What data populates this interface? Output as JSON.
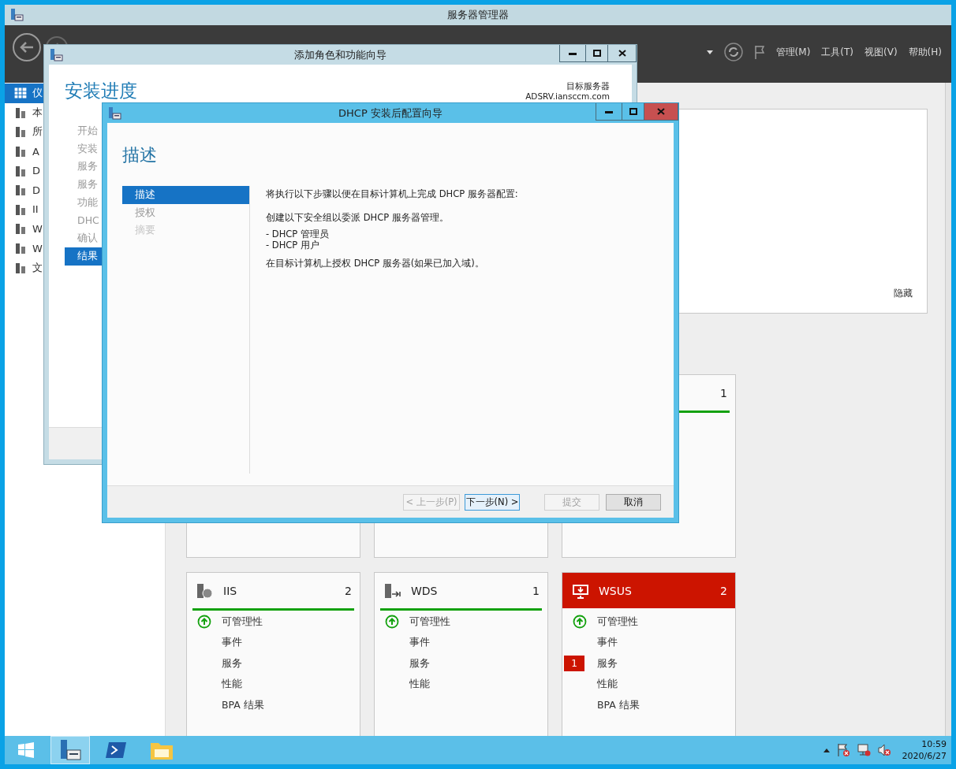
{
  "server_manager": {
    "title": "服务器管理器",
    "menus": [
      "管理(M)",
      "工具(T)",
      "视图(V)",
      "帮助(H)"
    ],
    "sidebar": [
      {
        "label": "仪",
        "selected": true
      },
      {
        "label": "本",
        "selected": false
      },
      {
        "label": "所",
        "selected": false
      },
      {
        "label": "A",
        "selected": false
      },
      {
        "label": "D",
        "selected": false
      },
      {
        "label": "D",
        "selected": false
      },
      {
        "label": "II",
        "selected": false
      },
      {
        "label": "W",
        "selected": false
      },
      {
        "label": "W",
        "selected": false
      },
      {
        "label": "文",
        "selected": false
      }
    ],
    "welcome_panel": {
      "hide_link": "隐藏"
    },
    "tiles": [
      [
        {
          "kind": "covered"
        },
        {
          "kind": "covered"
        },
        {
          "kind": "role",
          "count": "1",
          "alert": false
        }
      ],
      [
        {
          "kind": "role",
          "name": "IIS",
          "count": "2",
          "alert": false,
          "rows": [
            {
              "label": "可管理性",
              "ok": true
            },
            {
              "label": "事件",
              "ok": false
            },
            {
              "label": "服务",
              "ok": false
            },
            {
              "label": "性能",
              "ok": false
            },
            {
              "label": "BPA 结果",
              "ok": false
            }
          ]
        },
        {
          "kind": "role",
          "name": "WDS",
          "count": "1",
          "alert": false,
          "rows": [
            {
              "label": "可管理性",
              "ok": true
            },
            {
              "label": "事件",
              "ok": false
            },
            {
              "label": "服务",
              "ok": false
            },
            {
              "label": "性能",
              "ok": false
            }
          ]
        },
        {
          "kind": "role",
          "name": "WSUS",
          "count": "2",
          "alert": true,
          "rows": [
            {
              "label": "可管理性",
              "ok": true
            },
            {
              "label": "事件",
              "ok": false
            },
            {
              "label": "服务",
              "ok": false,
              "badge": "1"
            },
            {
              "label": "性能",
              "ok": false
            },
            {
              "label": "BPA 结果",
              "ok": false
            }
          ]
        }
      ]
    ]
  },
  "roles_wizard": {
    "title": "添加角色和功能向导",
    "heading": "安装进度",
    "target_label": "目标服务器",
    "target_server": "ADSRV.iansccm.com",
    "steps": [
      {
        "label": "开始",
        "selected": false
      },
      {
        "label": "安装",
        "selected": false
      },
      {
        "label": "服务",
        "selected": false
      },
      {
        "label": "服务",
        "selected": false
      },
      {
        "label": "功能",
        "selected": false
      },
      {
        "label": "DHC",
        "selected": false
      },
      {
        "label": "确认",
        "selected": false
      },
      {
        "label": "结果",
        "selected": true
      }
    ]
  },
  "dhcp_wizard": {
    "title": "DHCP 安装后配置向导",
    "heading": "描述",
    "steps": [
      {
        "label": "描述",
        "selected": true,
        "disabled": false
      },
      {
        "label": "授权",
        "selected": false,
        "disabled": false
      },
      {
        "label": "摘要",
        "selected": false,
        "disabled": true
      }
    ],
    "content": {
      "intro": "将执行以下步骤以便在目标计算机上完成 DHCP 服务器配置:",
      "groups_intro": "创建以下安全组以委派 DHCP 服务器管理。",
      "groups": [
        "- DHCP 管理员",
        "- DHCP 用户"
      ],
      "authorize": "在目标计算机上授权 DHCP 服务器(如果已加入域)。"
    },
    "buttons": [
      {
        "label": "< 上一步(P)",
        "disabled": true,
        "focused": false
      },
      {
        "label": "下一步(N) >",
        "disabled": false,
        "focused": true
      },
      {
        "label": "提交",
        "disabled": true,
        "focused": false
      },
      {
        "label": "取消",
        "disabled": false,
        "focused": false
      }
    ]
  },
  "taskbar": {
    "time": "10:59",
    "date": "2020/6/27"
  }
}
